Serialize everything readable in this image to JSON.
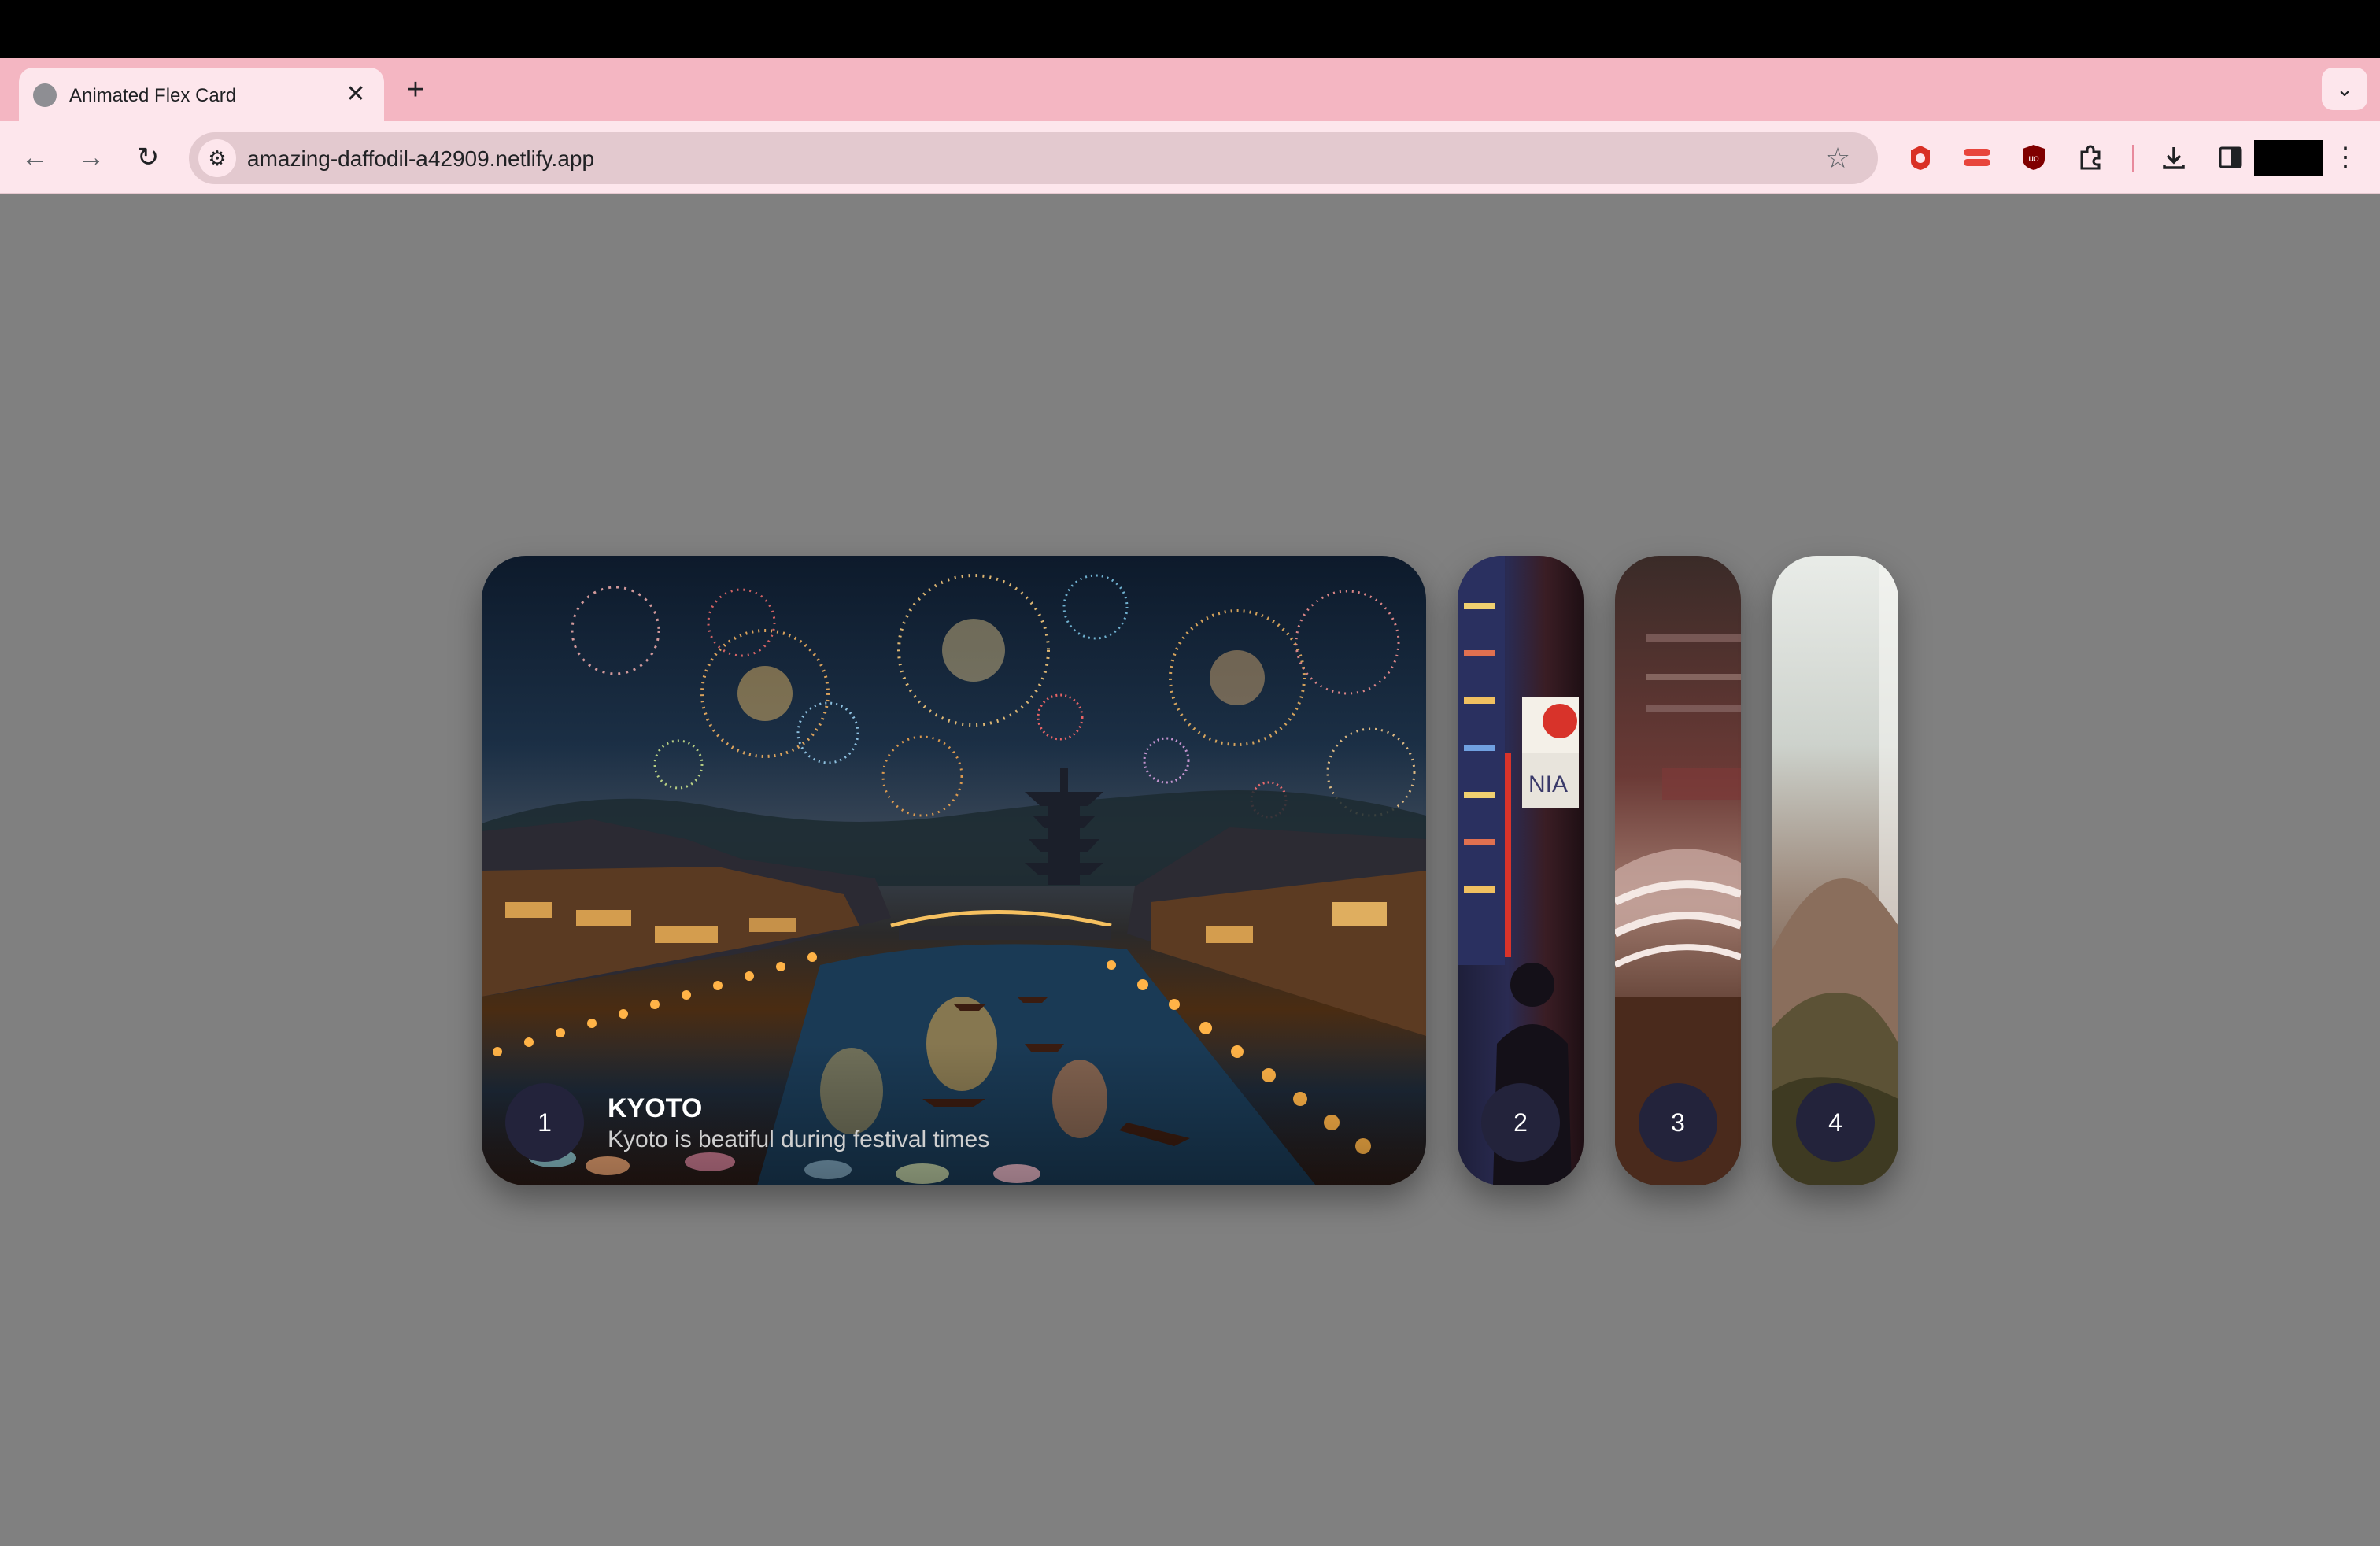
{
  "browser": {
    "tab_title": "Animated Flex Card",
    "tab_close": "✕",
    "new_tab": "+",
    "tab_search": "⌄",
    "url": "amazing-daffodil-a42909.netlify.app",
    "nav_back": "←",
    "nav_forward": "→",
    "nav_reload": "↻",
    "site_info": "⚙",
    "star": "☆",
    "menu": "⋮",
    "icons": [
      "globe-icon",
      "close-icon",
      "plus-icon",
      "chevron-down-icon",
      "back-arrow-icon",
      "forward-arrow-icon",
      "reload-icon",
      "site-settings-icon",
      "star-icon",
      "extension-icon",
      "puzzle-icon",
      "download-icon",
      "side-panel-icon",
      "kebab-menu-icon"
    ]
  },
  "cards": [
    {
      "number": "1",
      "title": "KYOTO",
      "description": "Kyoto is beatiful during festival times",
      "active": true
    },
    {
      "number": "2",
      "active": false
    },
    {
      "number": "3",
      "active": false
    },
    {
      "number": "4",
      "active": false
    }
  ],
  "colors": {
    "tabstrip": "#f4b6c2",
    "toolbar": "#fde6ec",
    "page_bg": "#808080",
    "badge_bg": "#23233b"
  }
}
